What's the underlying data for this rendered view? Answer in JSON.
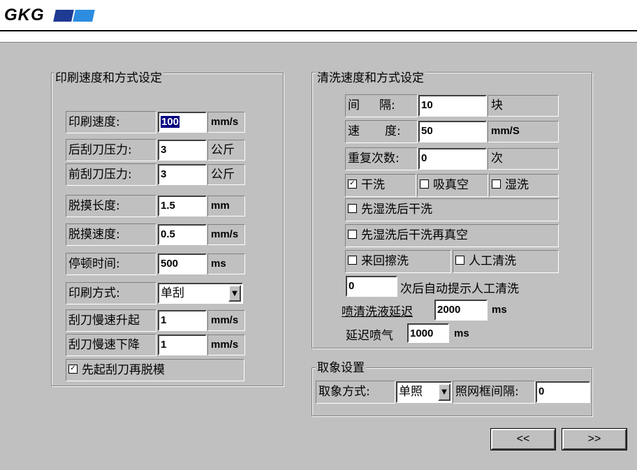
{
  "logo": {
    "text": "GKG"
  },
  "print_group": {
    "title": "印刷速度和方式设定",
    "rows": [
      {
        "label": "印刷速度:",
        "value": "100",
        "unit": "mm/s"
      },
      {
        "label": "后刮刀压力:",
        "value": "3",
        "unit": "公斤"
      },
      {
        "label": "前刮刀压力:",
        "value": "3",
        "unit": "公斤"
      },
      {
        "label": "脱摸长度:",
        "value": "1.5",
        "unit": "mm"
      },
      {
        "label": "脱摸速度:",
        "value": "0.5",
        "unit": "mm/s"
      },
      {
        "label": "停顿时间:",
        "value": "500",
        "unit": "ms"
      }
    ],
    "print_mode": {
      "label": "印刷方式:",
      "value": "单刮"
    },
    "slow_rise": {
      "label": "刮刀慢速升起",
      "value": "1",
      "unit": "mm/s"
    },
    "slow_down": {
      "label": "刮刀慢速下降",
      "value": "1",
      "unit": "mm/s"
    },
    "squeegee_first": {
      "label": "先起刮刀再脱模",
      "checked": true
    }
  },
  "clean_group": {
    "title": "清洗速度和方式设定",
    "interval": {
      "label_a": "间",
      "label_b": "隔:",
      "value": "10",
      "unit": "块"
    },
    "speed": {
      "label_a": "速",
      "label_b": "度:",
      "value": "50",
      "unit": "mm/S"
    },
    "repeat": {
      "label": "重复次数:",
      "value": "0",
      "unit": "次"
    },
    "dry": {
      "label": "干洗",
      "checked": true
    },
    "vacuum": {
      "label": "吸真空",
      "checked": false
    },
    "wet": {
      "label": "湿洗",
      "checked": false
    },
    "wet_then_dry": {
      "label": "先湿洗后干洗",
      "checked": false
    },
    "wet_dry_vacuum": {
      "label": "先湿洗后干洗再真空",
      "checked": false
    },
    "back_forth": {
      "label": "来回擦洗",
      "checked": false
    },
    "manual": {
      "label": "人工清洗",
      "checked": false
    },
    "auto_prompt": {
      "value": "0",
      "text": "次后自动提示人工清洗"
    },
    "spray_delay": {
      "label": "喷清洗液延迟",
      "value": "2000",
      "unit": "ms"
    },
    "air_delay": {
      "label": "延迟喷气",
      "value": "1000",
      "unit": "ms"
    }
  },
  "capture_group": {
    "title": "取象设置",
    "mode_label": "取象方式:",
    "mode_value": "单照",
    "interval_label": "照网框间隔:",
    "interval_value": "0"
  },
  "nav": {
    "prev": "<<",
    "next": ">>"
  }
}
